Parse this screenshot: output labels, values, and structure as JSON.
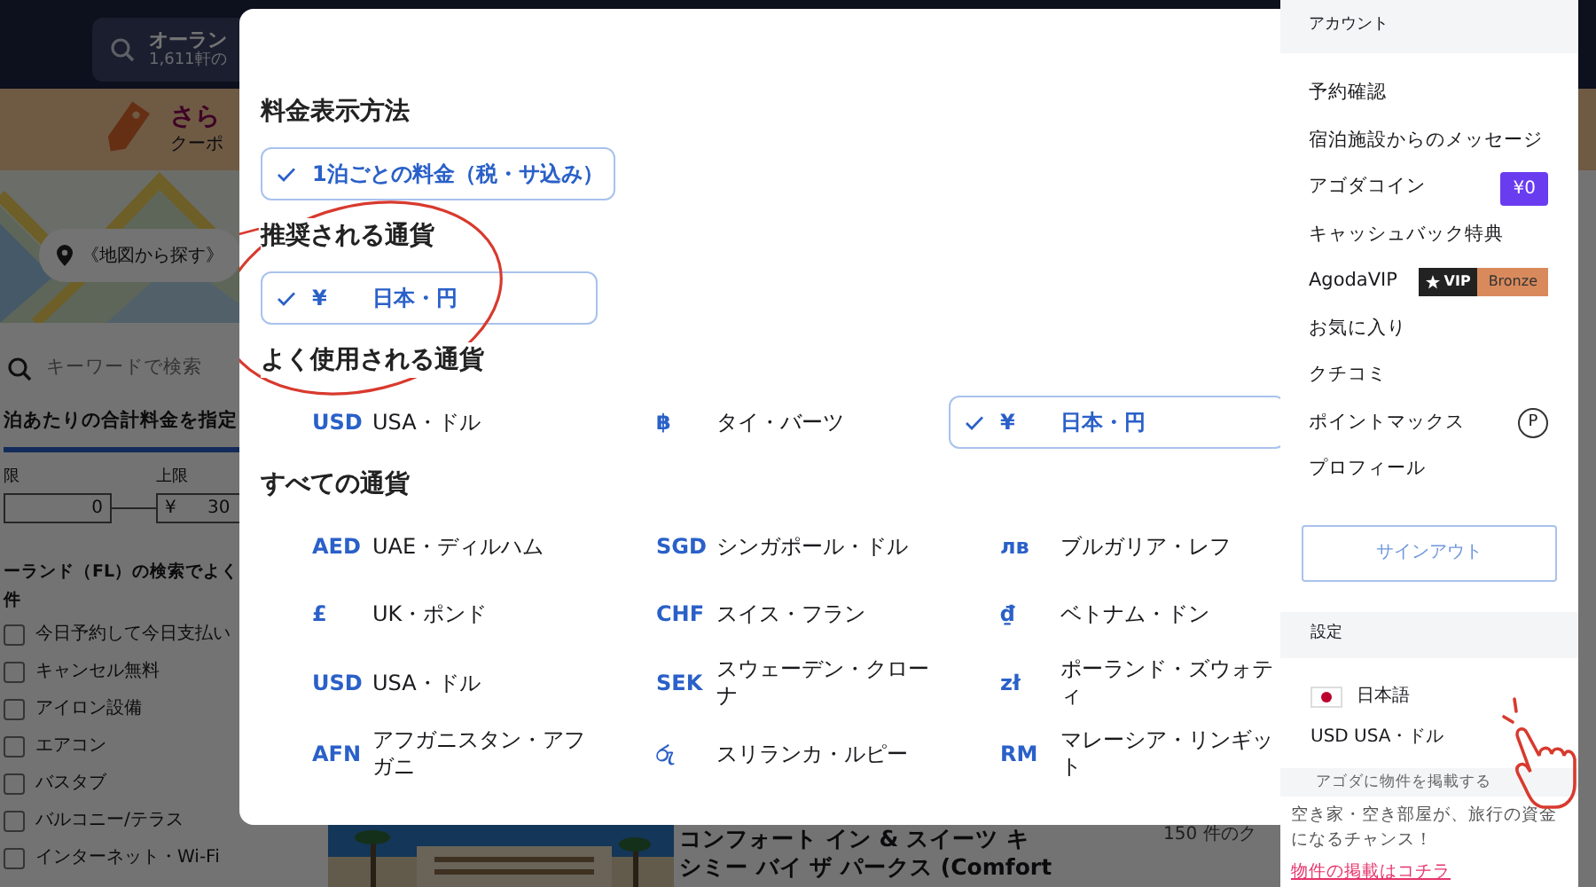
{
  "background": {
    "search": {
      "title": "オーラン",
      "subtitle": "1,611軒の"
    },
    "promo": {
      "title": "さら",
      "subtitle": "クーポ"
    },
    "map_button": "《地図から探す》",
    "keyword_placeholder": "キーワードで検索",
    "price_heading": "泊あたりの合計料金を指定",
    "price_min": {
      "label": "限",
      "value": "0"
    },
    "price_max": {
      "label": "上限",
      "currency": "¥",
      "value": "30"
    },
    "filters_heading": [
      "ーランド（FL）の検索でよく",
      "件"
    ],
    "filters": [
      {
        "label": "今日予約して今日支払い",
        "checked": false
      },
      {
        "label": "キャンセル無料",
        "checked": false
      },
      {
        "label": "アイロン設備",
        "checked": false
      },
      {
        "label": "エアコン",
        "checked": false
      },
      {
        "label": "バスタブ",
        "checked": false
      },
      {
        "label": "バルコニー/テラス",
        "checked": false
      },
      {
        "label": "インターネット・Wi-Fi",
        "checked": false
      }
    ],
    "hotel": {
      "title_lines": [
        "コンフォート イン & スイーツ キ",
        "シミー バイ ザ パークス (Comfort"
      ],
      "result_count": "150 件のク"
    }
  },
  "modal": {
    "price_display": {
      "title": "料金表示方法",
      "options": [
        {
          "name": "1泊ごとの料金（税・サ込み）",
          "selected": true
        }
      ]
    },
    "recommended": {
      "title": "推奨される通貨",
      "items": [
        {
          "code": "¥",
          "name": "日本・円",
          "selected": true
        }
      ]
    },
    "popular": {
      "title": "よく使用される通貨",
      "items": [
        {
          "code": "USD",
          "name": "USA・ドル",
          "selected": false
        },
        {
          "code": "฿",
          "name": "タイ・バーツ",
          "selected": false
        },
        {
          "code": "¥",
          "name": "日本・円",
          "selected": true
        }
      ]
    },
    "all": {
      "title": "すべての通貨",
      "items": [
        {
          "code": "AED",
          "name": "UAE・ディルハム",
          "selected": false
        },
        {
          "code": "SGD",
          "name": "シンガポール・ドル",
          "selected": false
        },
        {
          "code": "лв",
          "name": "ブルガリア・レフ",
          "selected": false
        },
        {
          "code": "£",
          "name": "UK・ポンド",
          "selected": false
        },
        {
          "code": "CHF",
          "name": "スイス・フラン",
          "selected": false
        },
        {
          "code": "₫",
          "name": "ベトナム・ドン",
          "selected": false
        },
        {
          "code": "USD",
          "name": "USA・ドル",
          "selected": false
        },
        {
          "code": "SEK",
          "name": "スウェーデン・クローナ",
          "selected": false
        },
        {
          "code": "zł",
          "name": "ポーランド・ズウォティ",
          "selected": false
        },
        {
          "code": "AFN",
          "name": "アフガニスタン・アフガニ",
          "selected": false
        },
        {
          "code": "රු",
          "name": "スリランカ・ルピー",
          "selected": false
        },
        {
          "code": "RM",
          "name": "マレーシア・リンギット",
          "selected": false
        }
      ]
    }
  },
  "account_panel": {
    "title": "アカウント",
    "items": [
      {
        "kind": "plain",
        "label": "予約確認"
      },
      {
        "kind": "plain",
        "label": "宿泊施設からのメッセージ"
      },
      {
        "kind": "coin",
        "label": "アゴダコイン",
        "badge": "¥0"
      },
      {
        "kind": "plain",
        "label": "キャッシュバック特典"
      },
      {
        "kind": "vip",
        "label": "AgodaVIP",
        "badge": "VIP",
        "tier": "Bronze"
      },
      {
        "kind": "plain",
        "label": "お気に入り"
      },
      {
        "kind": "plain",
        "label": "クチコミ"
      },
      {
        "kind": "points",
        "label": "ポイントマックス",
        "badge": "P"
      },
      {
        "kind": "plain",
        "label": "プロフィール"
      }
    ],
    "signout_button": "サインアウト",
    "settings": {
      "title": "設定",
      "language": "日本語",
      "currency_code": "USD",
      "currency_name": "USA・ドル"
    },
    "host": {
      "banner": "アゴダに物件を掲載する",
      "text": "空き家・空き部屋が、旅行の資金になるチャンス！",
      "link": "物件の掲載はコチラ"
    }
  }
}
